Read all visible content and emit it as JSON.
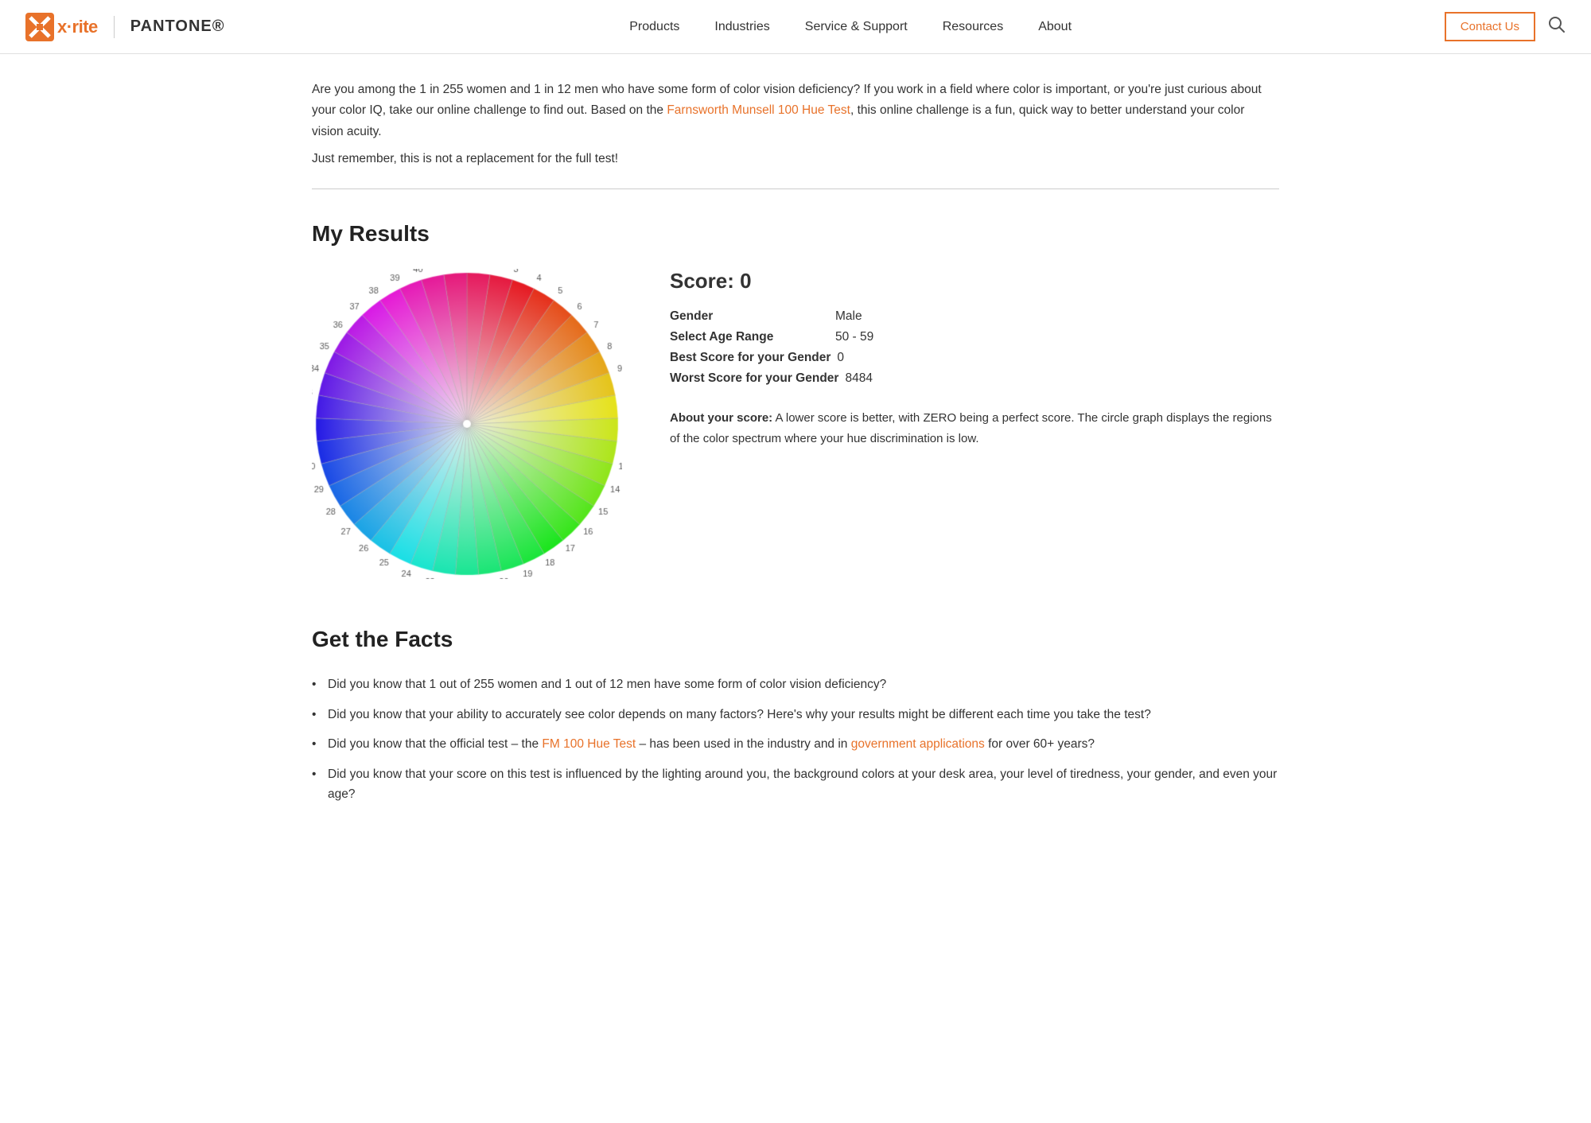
{
  "nav": {
    "logo_xrite": "x·rite",
    "logo_pantone": "PANTONE®",
    "links": [
      {
        "id": "products",
        "label": "Products"
      },
      {
        "id": "industries",
        "label": "Industries"
      },
      {
        "id": "service-support",
        "label": "Service & Support"
      },
      {
        "id": "resources",
        "label": "Resources"
      },
      {
        "id": "about",
        "label": "About"
      }
    ],
    "contact_label": "Contact Us",
    "search_icon": "🔍"
  },
  "intro": {
    "text1": "Are you among the 1 in 255 women and 1 in 12 men who have some form of color vision deficiency? If you work in a field where color is important, or you're just curious about your color IQ, take our online challenge to find out. Based on the ",
    "link_text": "Farnsworth Munsell 100 Hue Test",
    "text2": ", this online challenge is a fun, quick way to better understand your color vision acuity.",
    "note": "Just remember, this is not a replacement for the full test!"
  },
  "results": {
    "section_title": "My Results",
    "score_heading": "Score: 0",
    "rows": [
      {
        "label": "Gender",
        "value": "Male"
      },
      {
        "label": "Select Age Range",
        "value": "50 - 59"
      },
      {
        "label": "Best Score for your Gender",
        "value": "0"
      },
      {
        "label": "Worst Score for your Gender",
        "value": "8484"
      }
    ],
    "about_score_label": "About your score:",
    "about_score_text": " A lower score is better, with ZERO being a perfect score. The circle graph displays the regions of the color spectrum where your hue discrimination is low."
  },
  "facts": {
    "section_title": "Get the Facts",
    "items": [
      {
        "text": "Did you know that 1 out of 255 women and 1 out of 12 men have some form of color vision deficiency?",
        "links": []
      },
      {
        "text": "Did you know that your ability to accurately see color depends on many factors? Here's why your results might be different each time you take the test?",
        "links": []
      },
      {
        "text_before": "Did you know that the official test – the ",
        "link1_text": "FM 100 Hue Test",
        "text_middle": " – has been used in the industry and in ",
        "link2_text": "government applications",
        "text_after": " for over 60+ years?",
        "has_links": true
      },
      {
        "text": "Did you know that your score on this test is influenced by the lighting around you, the background colors at your desk area, your level of tiredness, your gender, and even your age?",
        "links": []
      }
    ]
  }
}
